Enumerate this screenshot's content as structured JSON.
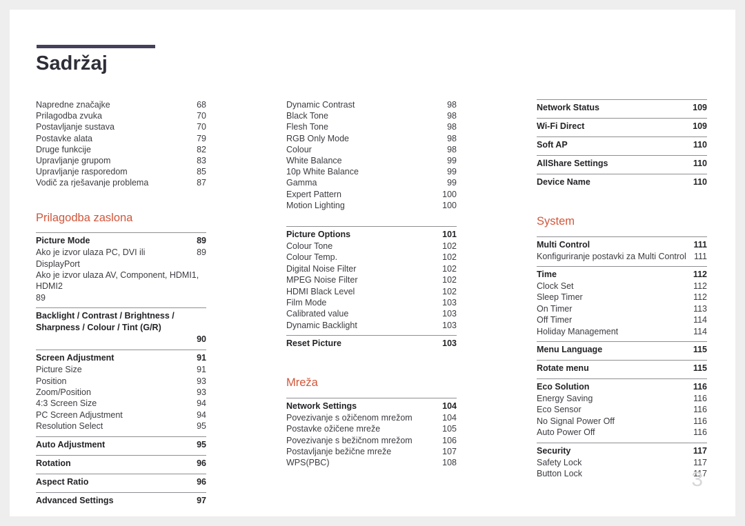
{
  "document": {
    "title": "Sadržaj",
    "folio": "3",
    "accent_color": "#d1563a",
    "rule_color": "#43425a"
  },
  "columns": [
    {
      "id": "column-1",
      "blocks": [
        {
          "kind": "plain-list",
          "name": "intro-entry-list",
          "entries": [
            {
              "label": "Napredne značajke",
              "page": "68"
            },
            {
              "label": "Prilagodba zvuka",
              "page": "70"
            },
            {
              "label": "Postavljanje sustava",
              "page": "70"
            },
            {
              "label": "Postavke alata",
              "page": "79"
            },
            {
              "label": "Druge funkcije",
              "page": "82"
            },
            {
              "label": "Upravljanje grupom",
              "page": "83"
            },
            {
              "label": "Upravljanje rasporedom",
              "page": "85"
            },
            {
              "label": "Vodič za rješavanje problema",
              "page": "87"
            }
          ]
        },
        {
          "kind": "spacer",
          "size": "lg"
        },
        {
          "kind": "heading",
          "name": "section-prilagodba-zaslona",
          "text": "Prilagodba zaslona"
        },
        {
          "kind": "group",
          "name": "group-picture-mode",
          "head": {
            "label": "Picture Mode",
            "page": "89"
          },
          "subs": [
            {
              "label": "Ako je izvor ulaza PC, DVI ili DisplayPort",
              "page": "89",
              "wrap": false
            },
            {
              "label": "Ako je izvor ulaza AV, Component, HDMI1, HDMI2",
              "page": "89",
              "wrap": true
            }
          ]
        },
        {
          "kind": "group",
          "name": "group-backlight-contrast",
          "head": {
            "label": "Backlight / Contrast / Brightness / Sharpness / Colour / Tint (G/R)",
            "page": "90",
            "wrap": true
          },
          "subs": []
        },
        {
          "kind": "group",
          "name": "group-screen-adjustment",
          "head": {
            "label": "Screen Adjustment",
            "page": "91"
          },
          "subs": [
            {
              "label": "Picture Size",
              "page": "91"
            },
            {
              "label": "Position",
              "page": "93"
            },
            {
              "label": "Zoom/Position",
              "page": "93"
            },
            {
              "label": "4:3 Screen Size",
              "page": "94"
            },
            {
              "label": "PC Screen Adjustment",
              "page": "94"
            },
            {
              "label": "Resolution Select",
              "page": "95"
            }
          ]
        },
        {
          "kind": "group",
          "name": "group-auto-adjustment",
          "head": {
            "label": "Auto Adjustment",
            "page": "95"
          },
          "subs": []
        },
        {
          "kind": "group",
          "name": "group-rotation",
          "head": {
            "label": "Rotation",
            "page": "96"
          },
          "subs": []
        },
        {
          "kind": "group",
          "name": "group-aspect-ratio",
          "head": {
            "label": "Aspect Ratio",
            "page": "96"
          },
          "subs": []
        },
        {
          "kind": "group",
          "name": "group-advanced-settings",
          "head": {
            "label": "Advanced Settings",
            "page": "97"
          },
          "subs": []
        }
      ]
    },
    {
      "id": "column-2",
      "blocks": [
        {
          "kind": "plain-list",
          "name": "advanced-settings-entry-list",
          "entries": [
            {
              "label": "Dynamic Contrast",
              "page": "98"
            },
            {
              "label": "Black Tone",
              "page": "98"
            },
            {
              "label": "Flesh Tone",
              "page": "98"
            },
            {
              "label": "RGB Only Mode",
              "page": "98"
            },
            {
              "label": "Colour",
              "page": "98"
            },
            {
              "label": "White Balance",
              "page": "99"
            },
            {
              "label": "10p White Balance",
              "page": "99"
            },
            {
              "label": "Gamma",
              "page": "99"
            },
            {
              "label": "Expert Pattern",
              "page": "100"
            },
            {
              "label": "Motion Lighting",
              "page": "100"
            }
          ]
        },
        {
          "kind": "spacer",
          "size": "md"
        },
        {
          "kind": "group",
          "name": "group-picture-options",
          "head": {
            "label": "Picture Options",
            "page": "101"
          },
          "subs": [
            {
              "label": "Colour Tone",
              "page": "102"
            },
            {
              "label": "Colour Temp.",
              "page": "102"
            },
            {
              "label": "Digital Noise Filter",
              "page": "102"
            },
            {
              "label": "MPEG Noise Filter",
              "page": "102"
            },
            {
              "label": "HDMI Black Level",
              "page": "102"
            },
            {
              "label": "Film Mode",
              "page": "103"
            },
            {
              "label": "Calibrated value",
              "page": "103"
            },
            {
              "label": "Dynamic Backlight",
              "page": "103"
            }
          ]
        },
        {
          "kind": "group",
          "name": "group-reset-picture",
          "head": {
            "label": "Reset Picture",
            "page": "103"
          },
          "subs": []
        },
        {
          "kind": "spacer",
          "size": "lg"
        },
        {
          "kind": "heading",
          "name": "section-mreza",
          "text": "Mreža"
        },
        {
          "kind": "group",
          "name": "group-network-settings",
          "head": {
            "label": "Network Settings",
            "page": "104"
          },
          "subs": [
            {
              "label": "Povezivanje s ožičenom mrežom",
              "page": "104"
            },
            {
              "label": "Postavke ožičene mreže",
              "page": "105"
            },
            {
              "label": "Povezivanje s bežičnom mrežom",
              "page": "106"
            },
            {
              "label": "Postavljanje bežične mreže",
              "page": "107"
            },
            {
              "label": "WPS(PBC)",
              "page": "108"
            }
          ]
        }
      ]
    },
    {
      "id": "column-3",
      "blocks": [
        {
          "kind": "group",
          "name": "group-network-status",
          "head": {
            "label": "Network Status",
            "page": "109"
          },
          "subs": []
        },
        {
          "kind": "group",
          "name": "group-wifi-direct",
          "head": {
            "label": "Wi-Fi Direct",
            "page": "109"
          },
          "subs": []
        },
        {
          "kind": "group",
          "name": "group-soft-ap",
          "head": {
            "label": "Soft AP",
            "page": "110"
          },
          "subs": []
        },
        {
          "kind": "group",
          "name": "group-allshare-settings",
          "head": {
            "label": "AllShare Settings",
            "page": "110"
          },
          "subs": []
        },
        {
          "kind": "group",
          "name": "group-device-name",
          "head": {
            "label": "Device Name",
            "page": "110"
          },
          "subs": []
        },
        {
          "kind": "spacer",
          "size": "lg"
        },
        {
          "kind": "heading",
          "name": "section-system",
          "text": "System"
        },
        {
          "kind": "group",
          "name": "group-multi-control",
          "head": {
            "label": "Multi Control",
            "page": "111"
          },
          "subs": [
            {
              "label": "Konfiguriranje postavki za Multi Control",
              "page": "111"
            }
          ]
        },
        {
          "kind": "group",
          "name": "group-time",
          "head": {
            "label": "Time",
            "page": "112"
          },
          "subs": [
            {
              "label": "Clock Set",
              "page": "112"
            },
            {
              "label": "Sleep Timer",
              "page": "112"
            },
            {
              "label": "On Timer",
              "page": "113"
            },
            {
              "label": "Off Timer",
              "page": "114"
            },
            {
              "label": "Holiday Management",
              "page": "114"
            }
          ]
        },
        {
          "kind": "group",
          "name": "group-menu-language",
          "head": {
            "label": "Menu Language",
            "page": "115"
          },
          "subs": []
        },
        {
          "kind": "group",
          "name": "group-rotate-menu",
          "head": {
            "label": "Rotate menu",
            "page": "115"
          },
          "subs": []
        },
        {
          "kind": "group",
          "name": "group-eco-solution",
          "head": {
            "label": "Eco Solution",
            "page": "116"
          },
          "subs": [
            {
              "label": "Energy Saving",
              "page": "116"
            },
            {
              "label": "Eco Sensor",
              "page": "116"
            },
            {
              "label": "No Signal Power Off",
              "page": "116"
            },
            {
              "label": "Auto Power Off",
              "page": "116"
            }
          ]
        },
        {
          "kind": "group",
          "name": "group-security",
          "head": {
            "label": "Security",
            "page": "117"
          },
          "subs": [
            {
              "label": "Safety Lock",
              "page": "117"
            },
            {
              "label": "Button Lock",
              "page": "117"
            }
          ]
        }
      ]
    }
  ]
}
